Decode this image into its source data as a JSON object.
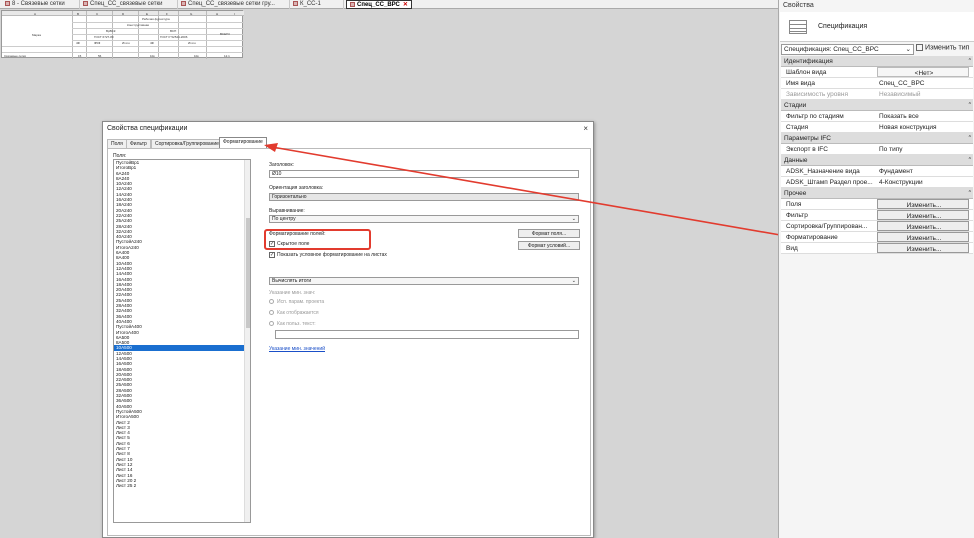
{
  "doc_tabs": [
    {
      "label": "8 - Связевые сетки",
      "active": false
    },
    {
      "label": "Спец_CC_связевые сетки",
      "active": false
    },
    {
      "label": "Спец_CC_связевые сетки гру...",
      "active": false
    },
    {
      "label": "К_CC-1",
      "active": false
    },
    {
      "label": "Спец_CC_ВРС",
      "active": true
    }
  ],
  "schedule_preview": {
    "columns": [
      "A",
      "B",
      "C",
      "D",
      "E",
      "F",
      "G",
      "H",
      "I"
    ],
    "rows": [
      "Марка",
      "Связевые сетки"
    ],
    "headers": [
      "Рабочая фурнитура",
      "Конструктивная",
      "ВрВСК",
      "ВСП",
      "ГОСТ 6727-80",
      "ГОСТ Р 52544-2006",
      "ВСЕГО",
      "4Ф",
      "Ф5Ф",
      "Итого",
      "4Ф",
      "Итого"
    ],
    "values": [
      "15",
      "56",
      "10к",
      "10к",
      "12.1"
    ]
  },
  "dialog": {
    "title": "Свойства спецификации",
    "close": "×",
    "tabs": [
      {
        "label": "Поля",
        "selected": false
      },
      {
        "label": "Фильтр",
        "selected": false
      },
      {
        "label": "Сортировка/Группирование",
        "selected": false
      },
      {
        "label": "Форматирование",
        "selected": true
      }
    ],
    "fields_label": "Поля:",
    "fields": [
      "ПустойВр1",
      "ИтогоВр1",
      "6А240",
      "8А240",
      "10А240",
      "12А240",
      "14А240",
      "16А240",
      "18А240",
      "20А240",
      "22А240",
      "25А240",
      "28А240",
      "32А240",
      "40А240",
      "ПустойА240",
      "ИтогоА240",
      "6А400",
      "8А400",
      "10А400",
      "12А400",
      "14А400",
      "16А400",
      "18А400",
      "20А400",
      "22А400",
      "25А400",
      "28А400",
      "32А400",
      "36А400",
      "40А400",
      "ПустойА400",
      "ИтогоА400",
      "6А500",
      "8А500",
      "10А500",
      "12А500",
      "14А500",
      "16А500",
      "18А500",
      "20А500",
      "22А500",
      "25А500",
      "28А500",
      "32А500",
      "36А500",
      "40А500",
      "ПустойА500",
      "ИтогоА500",
      "Лист 2",
      "Лист 3",
      "Лист 4",
      "Лист 5",
      "Лист 6",
      "Лист 7",
      "Лист 8",
      "Лист 10",
      "Лист 12",
      "Лист 14",
      "Лист 16",
      "Лист 20 2",
      "Лист 25 2"
    ],
    "selected_field": "10А500",
    "heading_label": "Заголовок:",
    "heading_value": "Ø10",
    "orientation_label": "Ориентация заголовка:",
    "orientation_value": "Горизонтально",
    "alignment_label": "Выравнивание:",
    "alignment_value": "По центру",
    "field_format_label": "Форматирование полей:",
    "field_format_button": "Формат поля...",
    "hidden_field_label": "Скрытое поле",
    "hidden_field_checked": "✓",
    "conditional_format_button": "Формат условий...",
    "show_conditional_label": "Показать условное форматирование на листах",
    "show_conditional_checked": "✓",
    "calc_totals_value": "Вычислять итоги",
    "min_digits_label": "Указание мин. знач:",
    "radio_project": "Исп. парам. проекта",
    "radio_as_shown": "Как отображается",
    "radio_custom": "Как польз. текст:",
    "units_link": "Указание мин. значений"
  },
  "properties": {
    "title": "Свойства",
    "type_name": "Спецификация",
    "instance_select": "Спецификация: Спец_CC_ВРС",
    "edit_type_label": "Изменить тип",
    "categories": [
      {
        "name": "Идентификация",
        "rows": [
          {
            "key": "Шаблон вида",
            "value": "<Нет>",
            "style": "button"
          },
          {
            "key": "Имя вида",
            "value": "Спец_CC_ВРС",
            "style": "text"
          },
          {
            "key": "Зависимость уровня",
            "value": "Независимый",
            "style": "disabled"
          }
        ]
      },
      {
        "name": "Стадии",
        "rows": [
          {
            "key": "Фильтр по стадиям",
            "value": "Показать все",
            "style": "text"
          },
          {
            "key": "Стадия",
            "value": "Новая конструкция",
            "style": "text"
          }
        ]
      },
      {
        "name": "Параметры IFC",
        "rows": [
          {
            "key": "Экспорт в IFC",
            "value": "По типу",
            "style": "text"
          }
        ]
      },
      {
        "name": "Данные",
        "rows": [
          {
            "key": "ADSK_Назначение вида",
            "value": "Фундамент",
            "style": "text"
          },
          {
            "key": "ADSK_Штамп Раздел прое...",
            "value": "4-Конструкции",
            "style": "text"
          }
        ]
      },
      {
        "name": "Прочее",
        "rows": [
          {
            "key": "Поля",
            "value": "Изменить...",
            "style": "button"
          },
          {
            "key": "Фильтр",
            "value": "Изменить...",
            "style": "button"
          },
          {
            "key": "Сортировка/Группирован...",
            "value": "Изменить...",
            "style": "button"
          },
          {
            "key": "Форматирование",
            "value": "Изменить...",
            "style": "button"
          },
          {
            "key": "Вид",
            "value": "Изменить...",
            "style": "button"
          }
        ]
      }
    ]
  },
  "colors": {
    "annotation": "#e23b2e",
    "selection": "#1a6fd0"
  }
}
